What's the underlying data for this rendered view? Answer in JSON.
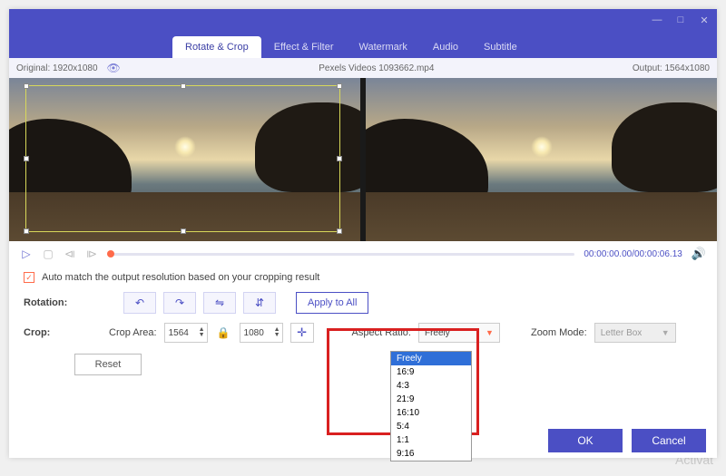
{
  "window": {
    "minimize": "—",
    "maximize": "□",
    "close": "✕"
  },
  "tabs": {
    "rotate_crop": "Rotate & Crop",
    "effect_filter": "Effect & Filter",
    "watermark": "Watermark",
    "audio": "Audio",
    "subtitle": "Subtitle"
  },
  "infobar": {
    "original_label": "Original:",
    "original_res": "1920x1080",
    "filename": "Pexels Videos 1093662.mp4",
    "output_label": "Output:",
    "output_res": "1564x1080"
  },
  "playback": {
    "current": "00:00:00.00",
    "sep": "/",
    "total": "00:00:06.13"
  },
  "automatch": {
    "label": "Auto match the output resolution based on your cropping result"
  },
  "rotation": {
    "label": "Rotation:",
    "apply_all": "Apply to All"
  },
  "crop": {
    "label": "Crop:",
    "area_label": "Crop Area:",
    "width": "1564",
    "height": "1080",
    "aspect_label": "Aspect Ratio:",
    "aspect_value": "Freely",
    "zoom_label": "Zoom Mode:",
    "zoom_value": "Letter Box",
    "reset": "Reset"
  },
  "aspect_options": [
    "Freely",
    "16:9",
    "4:3",
    "21:9",
    "16:10",
    "5:4",
    "1:1",
    "9:16"
  ],
  "footer": {
    "ok": "OK",
    "cancel": "Cancel"
  },
  "watermark_text": "Activat"
}
